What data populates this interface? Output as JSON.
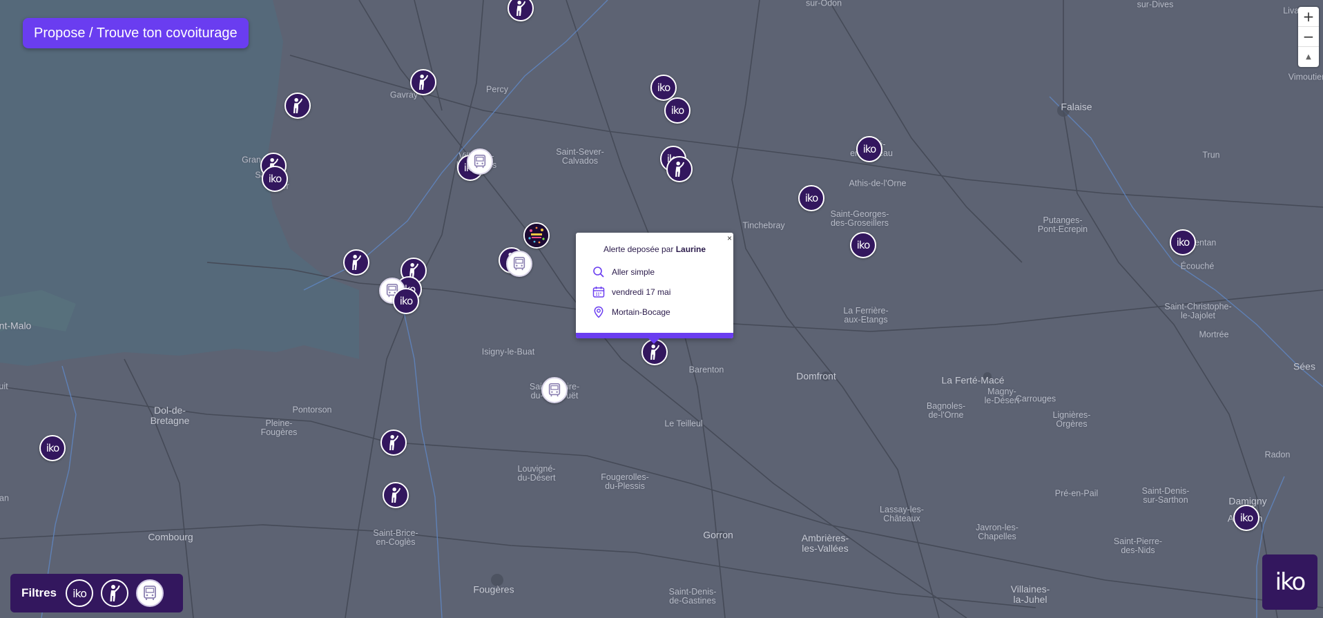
{
  "cta": {
    "label": "Propose / Trouve ton covoiturage"
  },
  "zoom": {
    "in": "+",
    "out": "−",
    "compass": "▲"
  },
  "popup": {
    "close": "×",
    "title_prefix": "Alerte deposée par",
    "author": "Laurine",
    "trip_type": "Aller simple",
    "date": "vendredi 17 mai",
    "place": "Mortain-Bocage",
    "icons": {
      "trip": "search-icon",
      "date": "calendar-icon",
      "place": "location-pin-icon"
    }
  },
  "filters": {
    "label": "Filtres",
    "items": [
      {
        "name": "iko",
        "icon": "iko-logo-icon"
      },
      {
        "name": "hitchhiker",
        "icon": "hitchhiker-icon"
      },
      {
        "name": "bus",
        "icon": "bus-icon"
      }
    ]
  },
  "logo": {
    "text": "iko"
  },
  "colors": {
    "land": "#5d6373",
    "sea": "#55697a",
    "accent": "#6a3df0",
    "marker": "#33175e",
    "river": "#5f86c2"
  },
  "places": [
    {
      "name": "sur-Odon"
    },
    {
      "name": "sur-Dives"
    },
    {
      "name": "Livarot"
    },
    {
      "name": "Vimoutier"
    },
    {
      "name": "Percy"
    },
    {
      "name": "Gavray"
    },
    {
      "name": "Falaise",
      "big": true
    },
    {
      "name": "Saint-Sever-\nCalvados"
    },
    {
      "name": "Villedieu-\nles-Poêles"
    },
    {
      "name": "Gran"
    },
    {
      "name": "Sa"
    },
    {
      "name": "er"
    },
    {
      "name": "Condé-\nen-Noireau"
    },
    {
      "name": "Athis-de-l'Orne"
    },
    {
      "name": "Trun"
    },
    {
      "name": "Saint-Georges-\ndes-Groseillers"
    },
    {
      "name": "Putanges-\nPont-Ecrepin"
    },
    {
      "name": "Tinchebray"
    },
    {
      "name": "Argentan"
    },
    {
      "name": "Écouché"
    },
    {
      "name": "Saint-Christophe-\nle-Jajolet"
    },
    {
      "name": "Mortrée"
    },
    {
      "name": "nt-Malo",
      "big": true
    },
    {
      "name": "La Ferrière-\naux-Etangs"
    },
    {
      "name": "Sées",
      "big": true
    },
    {
      "name": "Isigny-le-Buat"
    },
    {
      "name": "Barenton"
    },
    {
      "name": "Domfront",
      "big": true
    },
    {
      "name": "La Ferté-Macé",
      "big": true
    },
    {
      "name": "Magny-\nle-Désert"
    },
    {
      "name": "Saint-Hilaire-\ndu-Harcouët"
    },
    {
      "name": "uit"
    },
    {
      "name": "Dol-de-\nBretagne",
      "big": true
    },
    {
      "name": "Pontorson"
    },
    {
      "name": "Pleine-\nFougères"
    },
    {
      "name": "Bagnoles-\nde-l'Orne"
    },
    {
      "name": "Carrouges"
    },
    {
      "name": "Lignières-\nOrgères"
    },
    {
      "name": "Le Teilleul"
    },
    {
      "name": "Louvigné-\ndu-Désert"
    },
    {
      "name": "Fougerolles-\ndu-Plessis"
    },
    {
      "name": "Radon"
    },
    {
      "name": "Pré-en-Pail"
    },
    {
      "name": "Saint-Denis-\nsur-Sarthon"
    },
    {
      "name": "Damigny",
      "big": true
    },
    {
      "name": "Alençon",
      "big": true
    },
    {
      "name": "an"
    },
    {
      "name": "Combourg",
      "big": true
    },
    {
      "name": "Saint-Brice-\nen-Coglès"
    },
    {
      "name": "Gorron",
      "big": true
    },
    {
      "name": "Ambrières-\nles-Vallées",
      "big": true
    },
    {
      "name": "Lassay-les-\nChâteaux"
    },
    {
      "name": "Javron-les-\nChapelles"
    },
    {
      "name": "Saint-Pierre-\ndes-Nids"
    },
    {
      "name": "Fougères",
      "big": true
    },
    {
      "name": "Saint-Denis-\nde-Gastines"
    },
    {
      "name": "Villaines-\nla-Juhel",
      "big": true
    }
  ],
  "markers": [
    {
      "type": "hitch"
    },
    {
      "type": "hitch"
    },
    {
      "type": "hitch"
    },
    {
      "type": "iko"
    },
    {
      "type": "iko"
    },
    {
      "type": "hitch"
    },
    {
      "type": "iko"
    },
    {
      "type": "iko"
    },
    {
      "type": "bus"
    },
    {
      "type": "iko"
    },
    {
      "type": "hitch"
    },
    {
      "type": "iko"
    },
    {
      "type": "iko"
    },
    {
      "type": "event"
    },
    {
      "type": "hitch"
    },
    {
      "type": "bus"
    },
    {
      "type": "hitch"
    },
    {
      "type": "hitch"
    },
    {
      "type": "iko"
    },
    {
      "type": "bus"
    },
    {
      "type": "iko"
    },
    {
      "type": "iko"
    },
    {
      "type": "iko"
    },
    {
      "type": "hitch"
    },
    {
      "type": "bus"
    },
    {
      "type": "iko"
    },
    {
      "type": "hitch"
    },
    {
      "type": "hitch"
    },
    {
      "type": "iko"
    }
  ]
}
